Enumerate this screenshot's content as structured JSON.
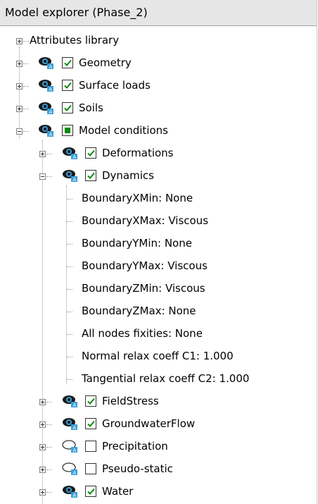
{
  "panel": {
    "title": "Model explorer (Phase_2)"
  },
  "tree": {
    "attributes_library": "Attributes library",
    "geometry": "Geometry",
    "surface_loads": "Surface loads",
    "soils": "Soils",
    "model_conditions": "Model conditions",
    "deformations": "Deformations",
    "dynamics": "Dynamics",
    "dynamics_props": [
      "BoundaryXMin: None",
      "BoundaryXMax: Viscous",
      "BoundaryYMin: None",
      "BoundaryYMax: Viscous",
      "BoundaryZMin: Viscous",
      "BoundaryZMax: None",
      "All nodes fixities: None",
      "Normal relax coeff C1: 1.000",
      "Tangential relax coeff C2: 1.000"
    ],
    "field_stress": "FieldStress",
    "groundwater_flow": "GroundwaterFlow",
    "precipitation": "Precipitation",
    "pseudo_static": "Pseudo-static",
    "water": "Water"
  },
  "icons": {
    "expander_plus": "plus-expander-icon",
    "expander_minus": "minus-expander-icon",
    "visible": "eye-visible-icon",
    "hidden": "eye-hidden-icon",
    "checked": "check-icon",
    "partial": "partial-check-icon"
  },
  "colors": {
    "check_green": "#0b8a0b",
    "eye_blue": "#3aa0d8",
    "header_bg": "#e6e6e6"
  }
}
